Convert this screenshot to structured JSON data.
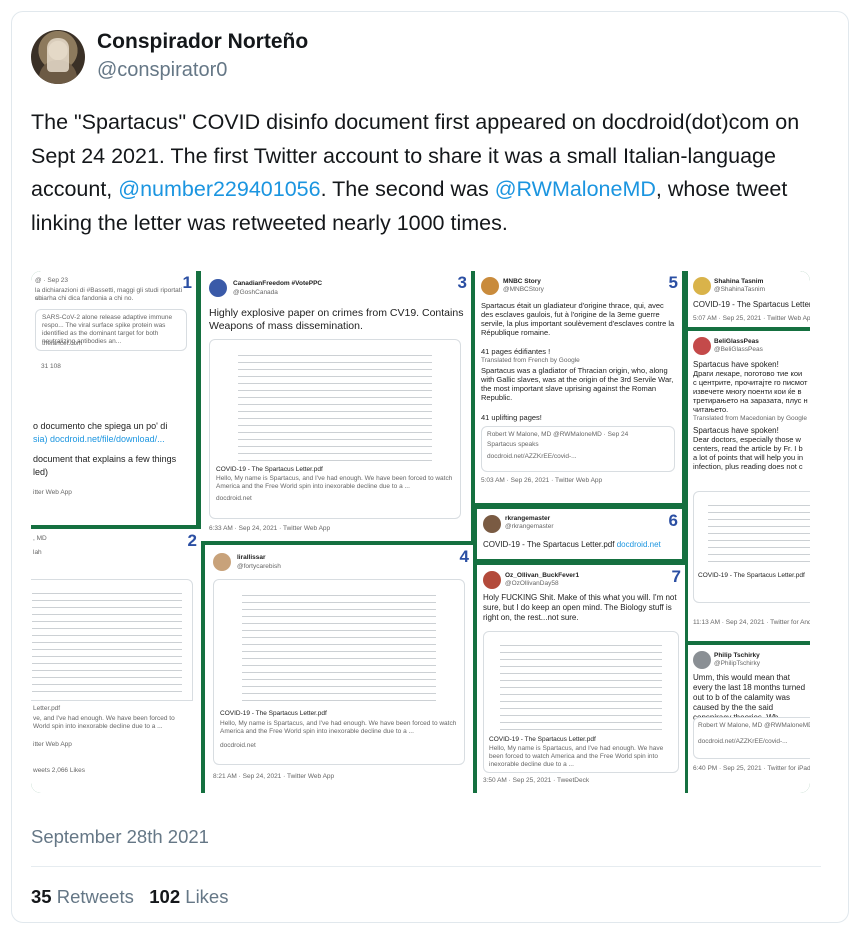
{
  "author": {
    "name": "Conspirador Norteño",
    "handle": "@conspirator0"
  },
  "tweet": {
    "text_1": "The \"Spartacus\" COVID disinfo document first appeared on docdroid(dot)com on Sept 24 2021. The first Twitter account to share it was a small Italian-language account, ",
    "mention_1": "@number229401056",
    "text_2": ". The second was ",
    "mention_2": "@RWMaloneMD",
    "text_3": ", whose tweet linking the letter was retweeted nearly 1000 times."
  },
  "media": {
    "panels": [
      {
        "num": "1",
        "header": "@ · Sep 23",
        "line1": "la dichiarazioni di #Bassetti, maggi gli studi riportati su",
        "line2": "chiarha chi dica fandonia a chi no.",
        "quote": "SARS-CoV-2 alone release adaptive immune respo... The viral surface spike protein was identified as the dominant target for both neutralizing antibodies an...",
        "quote_src": "thelancet.com",
        "counts": "31     108",
        "body1": "o documento che spiega un po' di",
        "body2": "sia) docdroid.net/file/download/...",
        "body3": "document that explains a few things",
        "body4": "led)",
        "footer": "itter Web App"
      },
      {
        "num": "2",
        "header": ", MD",
        "sub": "lah",
        "card_title": "Letter.pdf",
        "card_text": "ve, and I've had enough. We have been forced to World spin into inexorable decline due to a ...",
        "footer": "itter Web App",
        "counts": "weets   2,066 Likes"
      },
      {
        "num": "3",
        "header": "CanadianFreedom #VotePPC",
        "sub": "@GoshCanada",
        "body": "Highly explosive paper on crimes from CV19. Contains Weapons of mass dissemination.",
        "card_title": "COVID-19 - The Spartacus Letter.pdf",
        "card_text": "Hello, My name is Spartacus, and I've had enough. We have been forced to watch America and the Free World spin into inexorable decline due to a ...",
        "card_src": "docdroid.net",
        "footer": "6:33 AM · Sep 24, 2021 · Twitter Web App"
      },
      {
        "num": "4",
        "header": "lirallissar",
        "sub": "@fortycarebish",
        "card_title": "COVID-19 - The Spartacus Letter.pdf",
        "card_text": "Hello, My name is Spartacus, and I've had enough. We have been forced to watch America and the Free World spin into inexorable decline due to a ...",
        "card_src": "docdroid.net",
        "footer": "8:21 AM · Sep 24, 2021 · Twitter Web App"
      },
      {
        "num": "5",
        "header": "MNBC Story",
        "sub": "@MNBCStory",
        "body1": "Spartacus était un gladiateur d'origine thrace, qui, avec des esclaves gaulois, fut à l'origine de la 3eme guerre servile, la plus important soulèvement d'esclaves contre la République romaine.",
        "body2": "41 pages édifiantes !",
        "translate": "Translated from French by Google",
        "body3": "Spartacus was a gladiator of Thracian origin, who, along with Gallic slaves, was at the origin of the 3rd Servile War, the most important slave uprising against the Roman Republic.",
        "body4": "41 uplifting pages!",
        "quote": "Robert W Malone, MD @RWMaloneMD · Sep 24",
        "quote2": "Spartacus speaks",
        "quote3": "docdroid.net/AZZKrEE/covid-...",
        "footer": "5:03 AM · Sep 26, 2021 · Twitter Web App"
      },
      {
        "num": "6",
        "header": "rkrangemaster",
        "sub": "@rkrangemaster",
        "body": "COVID-19 - The Spartacus Letter.pdf",
        "link": "docdroid.net"
      },
      {
        "num": "7",
        "header": "Oz_Ollivan_BuckFever1",
        "sub": "@OzOllivanDay58",
        "body": "Holy FUCKING Shit. Make of this what you will. I'm not sure, but I do keep an open mind. The Biology stuff is right on, the rest...not sure.",
        "card_title": "COVID-19 - The Spartacus Letter.pdf",
        "card_text": "Hello, My name is Spartacus, and I've had enough. We have been forced to watch America and the Free World spin into inexorable decline due to a ...",
        "footer": "3:50 AM · Sep 25, 2021 · TweetDeck"
      },
      {
        "header": "Shahina Tasnim",
        "sub": "@ShahinaTasnim",
        "body": "COVID-19 - The Spartacus Letter.",
        "footer": "5:07 AM · Sep 25, 2021 · Twitter Web App"
      },
      {
        "header": "BeliGlassPeas",
        "sub": "@BeliGlassPeas",
        "body1": "Spartacus have spoken!",
        "body2": "Драги лекаре, поготово тие кои с центрите, прочитајте го писмот извечете многу поенти кои ќе в третирањето на заразата, плус н читањето.",
        "translate": "Translated from Macedonian by Google",
        "body3": "Spartacus have spoken!",
        "body4": "Dear doctors, especially those w centers, read the article by Fr. I b a lot of points that will help you in infection, plus reading does not c",
        "card_title": "COVID-19 - The Spartacus Letter.pdf",
        "footer": "11:13 AM · Sep 24, 2021 · Twitter for Android"
      },
      {
        "header": "Philip Tschirky",
        "sub": "@PhilipTschirky",
        "body": "Umm, this would mean that every the last 18 months turned out to b of the calamity was caused by the the said conspiracy theories. Wh",
        "quote": "Robert W Malone, MD @RWMaloneMD",
        "quote2": "docdroid.net/AZZKrEE/covid-...",
        "footer": "6:40 PM · Sep 25, 2021 · Twitter for iPad"
      }
    ]
  },
  "timestamp": "September 28th 2021",
  "stats": {
    "retweets_count": "35",
    "retweets_label": "Retweets",
    "likes_count": "102",
    "likes_label": "Likes"
  }
}
